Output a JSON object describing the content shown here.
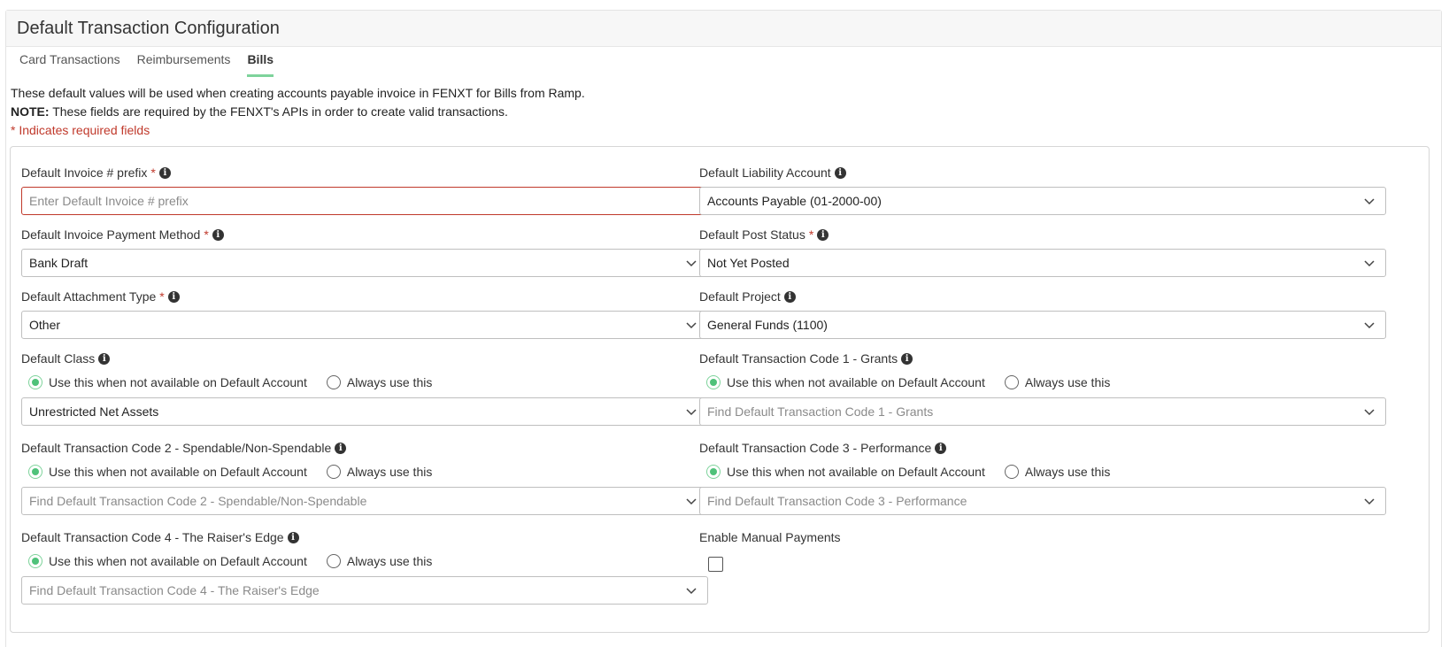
{
  "header": {
    "title": "Default Transaction Configuration"
  },
  "tabs": [
    {
      "label": "Card Transactions"
    },
    {
      "label": "Reimbursements"
    },
    {
      "label": "Bills"
    }
  ],
  "info": {
    "line1": "These default values will be used when creating accounts payable invoice in FENXT for Bills from Ramp.",
    "note_label": "NOTE:",
    "note_text": " These fields are required by the FENXT's APIs in order to create valid transactions.",
    "required_text": "* Indicates required fields"
  },
  "radio_labels": {
    "fallback": "Use this when not available on Default Account",
    "always": "Always use this"
  },
  "fields": {
    "invoice_prefix": {
      "label": "Default Invoice # prefix",
      "required": "*",
      "placeholder": "Enter Default Invoice # prefix"
    },
    "liability_account": {
      "label": "Default Liability Account",
      "value": "Accounts Payable (01-2000-00)"
    },
    "payment_method": {
      "label": "Default Invoice Payment Method",
      "required": "*",
      "value": "Bank Draft"
    },
    "post_status": {
      "label": "Default Post Status",
      "required": "*",
      "value": "Not Yet Posted"
    },
    "attachment_type": {
      "label": "Default Attachment Type",
      "required": "*",
      "value": "Other"
    },
    "project": {
      "label": "Default Project",
      "value": "General Funds (1100)"
    },
    "class": {
      "label": "Default Class",
      "value": "Unrestricted Net Assets"
    },
    "txn_code_1": {
      "label": "Default Transaction Code 1 - Grants",
      "placeholder": "Find Default Transaction Code 1 - Grants"
    },
    "txn_code_2": {
      "label": "Default Transaction Code 2 - Spendable/Non-Spendable",
      "placeholder": "Find Default Transaction Code 2 - Spendable/Non-Spendable"
    },
    "txn_code_3": {
      "label": "Default Transaction Code 3 - Performance",
      "placeholder": "Find Default Transaction Code 3 - Performance"
    },
    "txn_code_4": {
      "label": "Default Transaction Code 4 - The Raiser's Edge",
      "placeholder": "Find Default Transaction Code 4 - The Raiser's Edge"
    },
    "manual_payments": {
      "label": "Enable Manual Payments"
    }
  },
  "colors": {
    "accent_green": "#4fc27a",
    "required_red": "#c0392b",
    "tab_underline": "#7ed39b"
  },
  "icons": {
    "info": "info-circle-icon",
    "chevron": "chevron-down-icon"
  }
}
